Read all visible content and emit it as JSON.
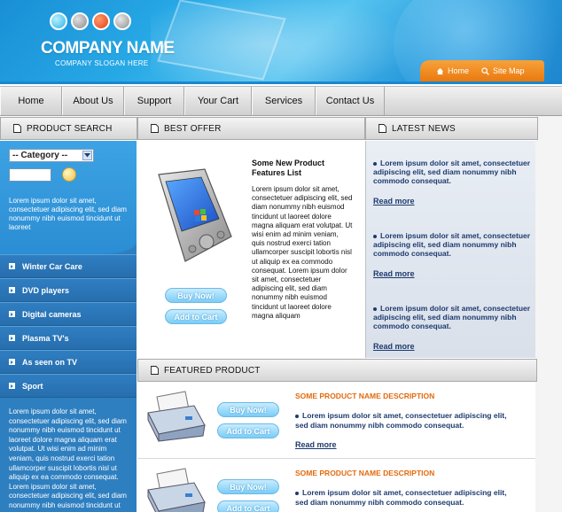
{
  "header": {
    "company_name": "COMPANY NAME",
    "slogan": "COMPANY SLOGAN HERE",
    "links": [
      {
        "label": "Home",
        "icon": "home-icon"
      },
      {
        "label": "Site Map",
        "icon": "search-icon"
      }
    ]
  },
  "nav": {
    "items": [
      "Home",
      "About Us",
      "Support",
      "Your Cart",
      "Services",
      "Contact Us"
    ]
  },
  "sections": {
    "product_search": "PRODUCT SEARCH",
    "best_offer": "BEST OFFER",
    "latest_news": "LATEST NEWS",
    "featured_product": "FEATURED PRODUCT"
  },
  "search": {
    "category_selected": "-- Category --",
    "description": "Lorem ipsum dolor sit amet, consectetuer adipiscing elit, sed diam nonummy nibh euismod tincidunt ut laoreet"
  },
  "categories": [
    "Winter Car Care",
    "DVD players",
    "Digital cameras",
    "Plasma TV's",
    "As seen on TV",
    "Sport"
  ],
  "left_text": "Lorem ipsum dolor sit amet, consectetuer adipiscing elit, sed diam nonummy nibh euismod tincidunt ut laoreet dolore magna aliquam erat volutpat. Ut wisi enim ad minim veniam, quis nostrud exerci tation ullamcorper suscipit lobortis nisl ut aliquip ex ea commodo consequat. Lorem ipsum dolor sit amet, consectetuer adipiscing elit, sed diam nonummy nibh euismod tincidunt ut laoreet",
  "offer": {
    "title": "Some New Product Features List",
    "text": "Lorem ipsum dolor sit amet, consectetuer adipiscing elit, sed diam nonummy nibh euismod tincidunt ut laoreet dolore magna aliquam erat volutpat. Ut wisi enim ad minim veniam, quis nostrud exerci tation ullamcorper suscipit lobortis nisl ut aliquip ex ea commodo consequat. Lorem ipsum dolor sit amet, consectetuer adipiscing elit, sed diam nonummy nibh euismod tincidunt ut laoreet dolore magna aliquam",
    "buy_label": "Buy Now!",
    "cart_label": "Add to Cart"
  },
  "news": {
    "items": [
      "Lorem ipsum dolor sit amet, consectetuer adipiscing elit, sed diam nonummy nibh commodo consequat.",
      "Lorem ipsum dolor sit amet, consectetuer adipiscing elit, sed diam nonummy nibh commodo consequat.",
      "Lorem ipsum dolor sit amet, consectetuer adipiscing elit, sed diam nonummy nibh commodo consequat."
    ],
    "read_more": "Read more"
  },
  "featured": {
    "items": [
      {
        "title": "SOME PRODUCT NAME DESCRIPTION",
        "text": "Lorem ipsum dolor sit amet, consectetuer adipiscing elit, sed diam nonummy nibh commodo consequat.",
        "read_more": "Read more",
        "buy_label": "Buy Now!",
        "cart_label": "Add to Cart"
      },
      {
        "title": "SOME PRODUCT NAME DESCRIPTION",
        "text": "Lorem ipsum dolor sit amet, consectetuer adipiscing elit, sed diam nonummy nibh commodo consequat.",
        "buy_label": "Buy Now!",
        "cart_label": "Add to Cart"
      }
    ]
  },
  "colors": {
    "header_blue": "#27a9e6",
    "tab_orange": "#e9790f",
    "sidebar_blue": "#2e7fc0",
    "news_text": "#1d3a6e",
    "featured_title": "#e36a0e"
  }
}
